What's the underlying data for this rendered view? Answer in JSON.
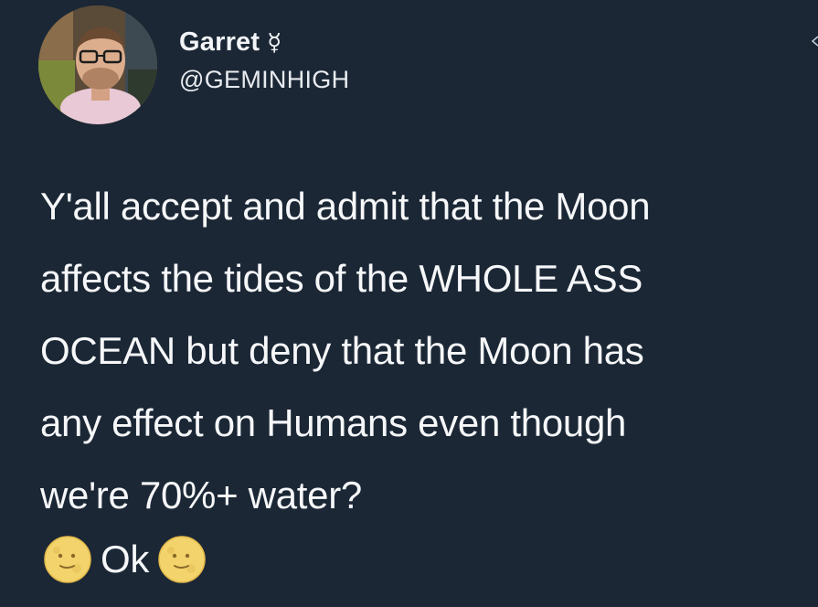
{
  "tweet": {
    "author": {
      "display_name": "Garret",
      "badge_glyph": "☿",
      "handle": "@GEMINHIGH"
    },
    "body_lines": [
      "Y'all accept and admit that the Moon",
      "affects the tides of the WHOLE ASS",
      "OCEAN but deny that the Moon has",
      "any effect on Humans even though",
      "we're 70%+ water?"
    ],
    "sign_off": {
      "leading_emoji": "full-moon-face-icon",
      "text": "Ok",
      "trailing_emoji": "full-moon-face-icon"
    }
  },
  "colors": {
    "background": "#1b2735",
    "text": "#f6f7f9",
    "moon_emoji": "#f3d36b"
  }
}
